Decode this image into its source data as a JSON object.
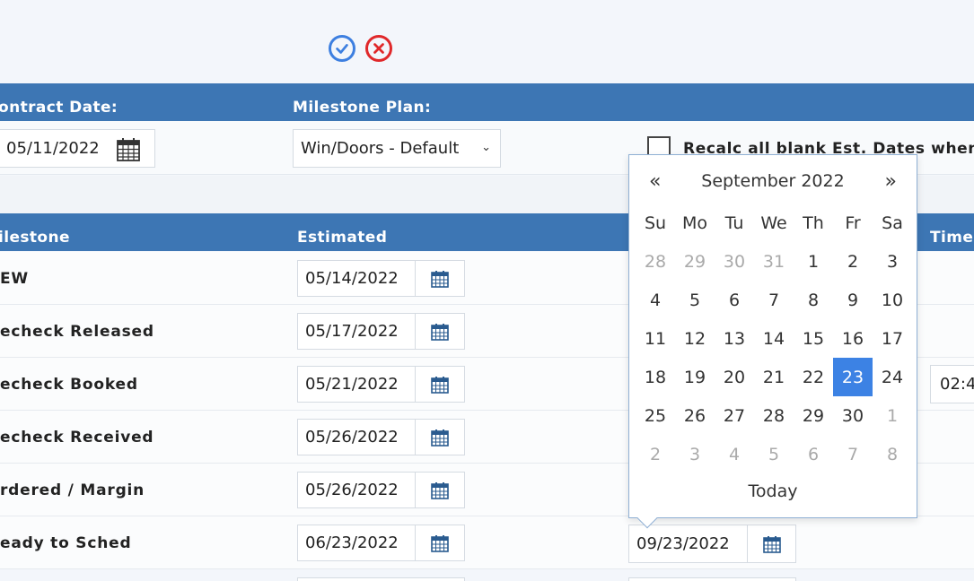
{
  "actions": {
    "confirm_icon": "check-circle-icon",
    "cancel_icon": "x-circle-icon",
    "confirm_color": "#3d7fe0",
    "cancel_color": "#e0282a"
  },
  "header": {
    "contract_date_label": "ontract Date:",
    "milestone_plan_label": "Milestone Plan:"
  },
  "contract_date": "05/11/2022",
  "milestone_plan": {
    "selected": "Win/Doors - Default"
  },
  "recalc": {
    "label": "Recalc all blank Est. Dates when",
    "checked": false
  },
  "table": {
    "col_milestone": "ilestone",
    "col_estimated": "Estimated",
    "col_time": "Time",
    "rows": [
      {
        "name": "EW",
        "estimated": "05/14/2022"
      },
      {
        "name": "echeck Released",
        "estimated": "05/17/2022"
      },
      {
        "name": "echeck Booked",
        "estimated": "05/21/2022",
        "time": "02:4"
      },
      {
        "name": "echeck Received",
        "estimated": "05/26/2022"
      },
      {
        "name": "rdered / Margin",
        "estimated": "05/26/2022"
      },
      {
        "name": "eady to Sched",
        "estimated": "06/23/2022",
        "actual": "09/23/2022"
      }
    ]
  },
  "datepicker": {
    "prev": "«",
    "next": "»",
    "month": "September 2022",
    "weekdays": [
      "Su",
      "Mo",
      "Tu",
      "We",
      "Th",
      "Fr",
      "Sa"
    ],
    "weeks": [
      [
        "28",
        "29",
        "30",
        "31",
        "1",
        "2",
        "3"
      ],
      [
        "4",
        "5",
        "6",
        "7",
        "8",
        "9",
        "10"
      ],
      [
        "11",
        "12",
        "13",
        "14",
        "15",
        "16",
        "17"
      ],
      [
        "18",
        "19",
        "20",
        "21",
        "22",
        "23",
        "24"
      ],
      [
        "25",
        "26",
        "27",
        "28",
        "29",
        "30",
        "1"
      ],
      [
        "2",
        "3",
        "4",
        "5",
        "6",
        "7",
        "8"
      ]
    ],
    "selected_day": "23",
    "today_label": "Today",
    "accent": "#3c82e4"
  },
  "colors": {
    "header_band": "#3d76b4"
  }
}
